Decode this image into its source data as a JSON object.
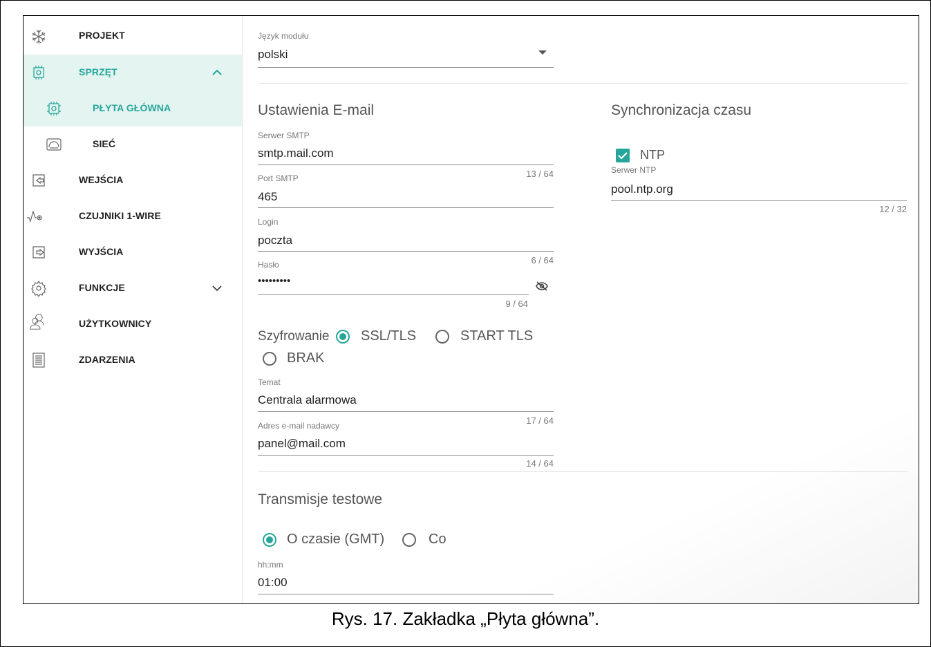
{
  "sidebar": {
    "items": [
      {
        "label": "PROJEKT",
        "icon": "snowflake-icon"
      },
      {
        "label": "SPRZĘT",
        "icon": "chip-icon"
      },
      {
        "label": "PŁYTA GŁÓWNA",
        "icon": "chip-gear-icon"
      },
      {
        "label": "SIEĆ",
        "icon": "network-icon"
      },
      {
        "label": "WEJŚCIA",
        "icon": "input-icon"
      },
      {
        "label": "CZUJNIKI 1-WIRE",
        "icon": "sensor-icon"
      },
      {
        "label": "WYJŚCIA",
        "icon": "output-icon"
      },
      {
        "label": "FUNKCJE",
        "icon": "gear-icon"
      },
      {
        "label": "UŻYTKOWNICY",
        "icon": "users-icon"
      },
      {
        "label": "ZDARZENIA",
        "icon": "document-icon"
      }
    ],
    "accent_color": "#26a69a",
    "active_bg": "#e3f4f1"
  },
  "language": {
    "label": "Język modułu",
    "value": "polski"
  },
  "email": {
    "title": "Ustawienia E-mail",
    "smtp_server": {
      "label": "Serwer SMTP",
      "value": "smtp.mail.com",
      "counter": "13 / 64"
    },
    "smtp_port": {
      "label": "Port SMTP",
      "value": "465"
    },
    "login": {
      "label": "Login",
      "value": "poczta",
      "counter": "6 / 64"
    },
    "password": {
      "label": "Hasło",
      "value": "•••••••••",
      "counter": "9 / 64"
    },
    "encryption": {
      "label": "Szyfrowanie",
      "options": [
        "SSL/TLS",
        "START TLS",
        "BRAK"
      ],
      "selected": "SSL/TLS"
    },
    "subject": {
      "label": "Temat",
      "value": "Centrala alarmowa",
      "counter": "17 / 64"
    },
    "sender": {
      "label": "Adres e-mail nadawcy",
      "value": "panel@mail.com",
      "counter": "14 / 64"
    }
  },
  "time_sync": {
    "title": "Synchronizacja czasu",
    "ntp_label": "NTP",
    "ntp_checked": true,
    "server": {
      "label": "Serwer NTP",
      "value": "pool.ntp.org",
      "counter": "12 / 32"
    }
  },
  "test": {
    "title": "Transmisje testowe",
    "options": [
      "O czasie (GMT)",
      "Co"
    ],
    "selected": "O czasie (GMT)",
    "time": {
      "label": "hh:mm",
      "value": "01:00"
    }
  },
  "caption": "Rys. 17. Zakładka „Płyta główna”."
}
